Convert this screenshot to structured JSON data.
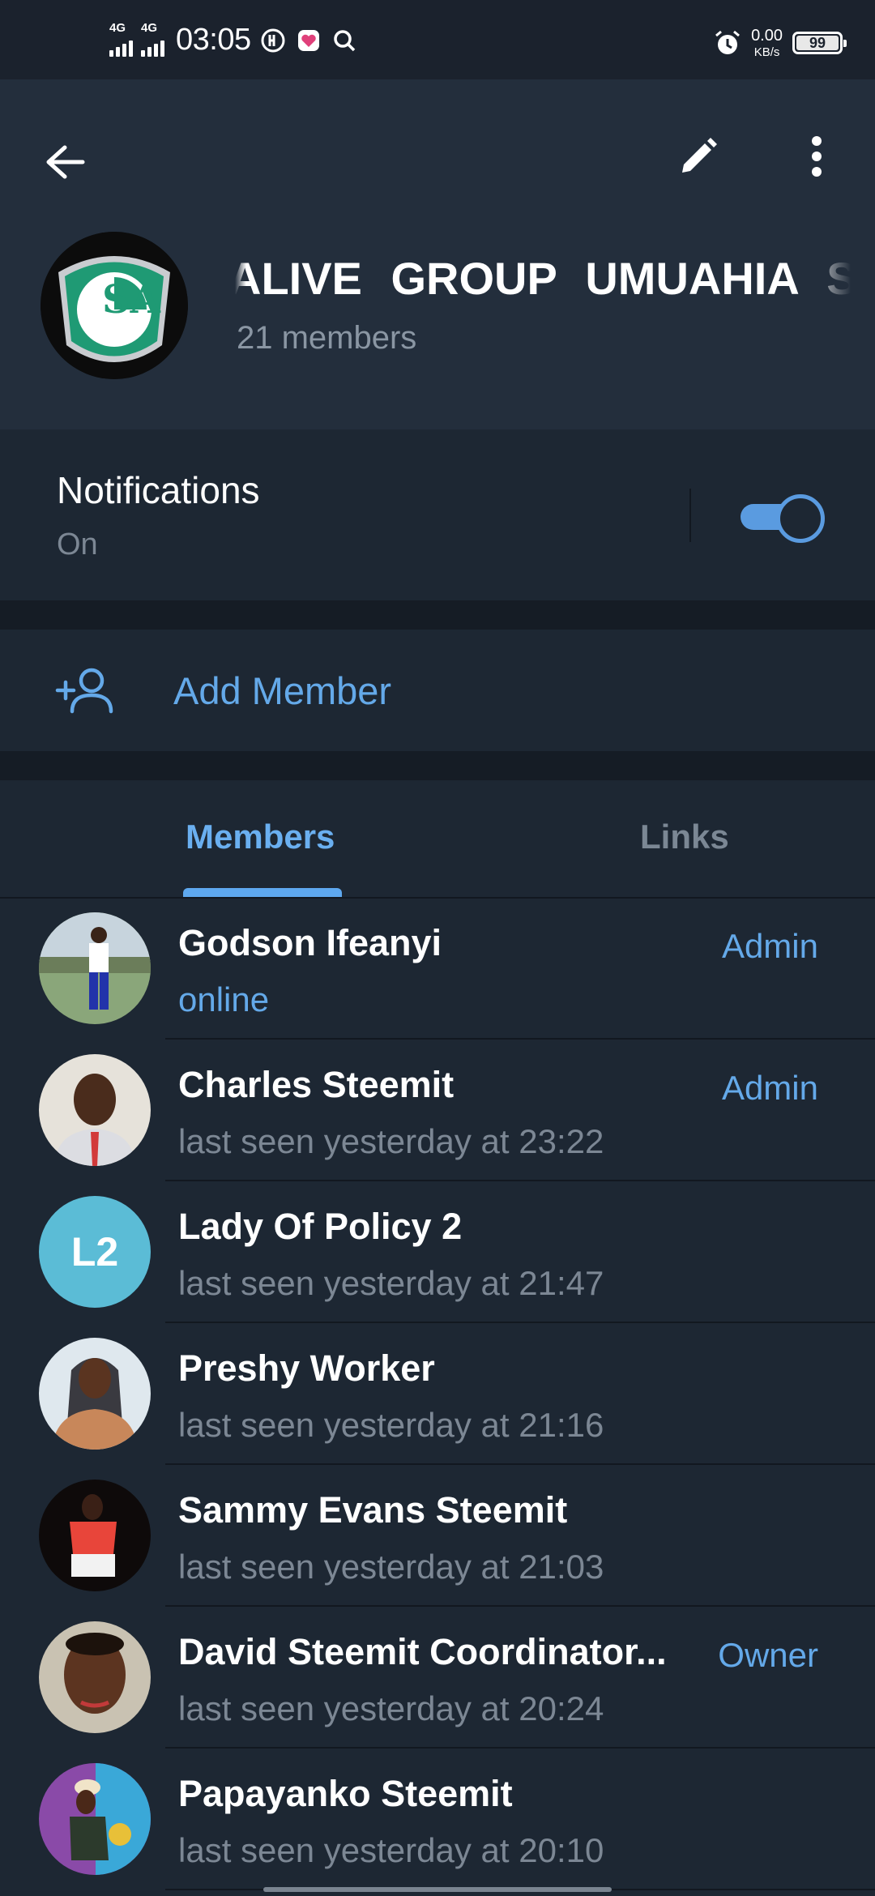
{
  "status_bar": {
    "net1": "4G",
    "net2": "4G",
    "time": "03:05",
    "speed_value": "0.00",
    "speed_unit": "KB/s",
    "battery": "99"
  },
  "header": {
    "title": "ALIVE GROUP   UMUAHIA S",
    "member_count": "21 members",
    "avatar_letters": "SA"
  },
  "notifications": {
    "title": "Notifications",
    "state": "On",
    "enabled": true
  },
  "add_member": {
    "label": "Add Member"
  },
  "tabs": {
    "members": "Members",
    "links": "Links",
    "active": "members"
  },
  "members": [
    {
      "name": "Godson Ifeanyi",
      "status": "online",
      "role": "Admin"
    },
    {
      "name": "Charles Steemit",
      "status": "last seen yesterday at 23:22",
      "role": "Admin"
    },
    {
      "name": "Lady Of Policy 2",
      "status": "last seen yesterday at 21:47",
      "role": "",
      "initials": "L2"
    },
    {
      "name": "Preshy Worker",
      "status": "last seen yesterday at 21:16",
      "role": ""
    },
    {
      "name": "Sammy Evans Steemit",
      "status": "last seen yesterday at 21:03",
      "role": ""
    },
    {
      "name": "David Steemit Coordinator...",
      "status": "last seen yesterday at 20:24",
      "role": "Owner"
    },
    {
      "name": "Papayanko Steemit",
      "status": "last seen yesterday at 20:10",
      "role": ""
    }
  ],
  "colors": {
    "accent": "#64a9e9",
    "background": "#1d2733",
    "header": "#232e3c"
  }
}
